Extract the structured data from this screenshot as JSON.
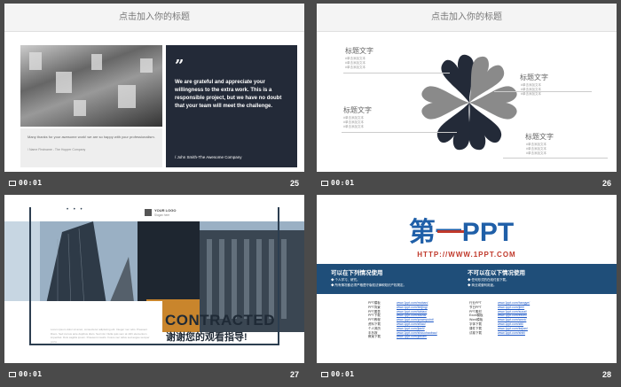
{
  "slides": [
    {
      "header": "点击加入你的标题",
      "quote_mark": "”",
      "quote_text": "We are grateful and appreciate your willingness to the extra work. This is a responsible project, but we have no doubt that your team will meet the challenge.",
      "quote_author": "/ John Smith-The Awesome Company",
      "left_quote": "Many thanks for your awesome work! we are so happy with your professionalism.",
      "left_author": "/ Name Firstname - The Hopper Company",
      "time": "00:01",
      "number": "25"
    },
    {
      "header": "点击加入你的标题",
      "labels": [
        {
          "title": "标题文字",
          "lines": [
            "#单击添加文本",
            "#单击添加文本",
            "#单击添加文本"
          ]
        },
        {
          "title": "标题文字",
          "lines": [
            "#单击添加文本",
            "#单击添加文本",
            "#单击添加文本"
          ]
        },
        {
          "title": "标题文字",
          "lines": [
            "#单击添加文本",
            "#单击添加文本",
            "#单击添加文本"
          ]
        },
        {
          "title": "标题文字",
          "lines": [
            "#单击添加文本",
            "#单击添加文本",
            "#单击添加文本"
          ]
        }
      ],
      "time": "00:01",
      "number": "26"
    },
    {
      "dots": "• • •",
      "logo_title": "YOUR LOGO",
      "logo_sub": "Slogan here",
      "title": "CONTRACTED",
      "subtitle": "谢谢您的观看指导!",
      "paragraph": "Lorem ipsum dolor sit amet, consectetur adipiscing elit. Integer nec odio. Praesent libero. Sed cursus ante dapibus diam. Sed nisi. Nulla quis sem at nibh elementum imperdiet. Duis sagittis ipsum. Praesent mauris. Fusce nec tellus sed augue semper porta.",
      "time": "00:01",
      "number": "27"
    },
    {
      "brand": "第一PPT",
      "url": "HTTP://WWW.1PPT.COM",
      "can_use": {
        "title": "可以在下列情况使用",
        "items": [
          "◆ 个人学习、研究。",
          "◆ 所有情况都必须严格遵守版权法律和知识产权规定。"
        ]
      },
      "cannot_use": {
        "title": "不可以在以下情况使用",
        "items": [
          "◆ 任何形式的在线付费下载。",
          "◆ 商业或营利用途。"
        ]
      },
      "links_left": [
        {
          "k": "PPT模板",
          "v": "www.1ppt.com/moban/"
        },
        {
          "k": "PPT背景",
          "v": "www.1ppt.com/beijing/"
        },
        {
          "k": "PPT图表",
          "v": "www.1ppt.com/tubiao/"
        },
        {
          "k": "PPT下载",
          "v": "www.1ppt.com/xiazai/"
        },
        {
          "k": "PPT教程",
          "v": "www.1ppt.com/powerpoint/"
        },
        {
          "k": "资料下载",
          "v": "www.1ppt.com/ziliao/"
        },
        {
          "k": "个人简历",
          "v": "www.1ppt.com/jianli/"
        },
        {
          "k": "手抄报",
          "v": "www.1ppt.com/shouchaobao/"
        },
        {
          "k": "教案下载",
          "v": "www.1ppt.com/jiaoan/"
        }
      ],
      "links_right": [
        {
          "k": "行业PPT",
          "v": "www.1ppt.com/hangye/"
        },
        {
          "k": "节日PPT",
          "v": "www.1ppt.com/jieri/"
        },
        {
          "k": "PPT素材",
          "v": "www.1ppt.com/sucai/"
        },
        {
          "k": "Excel模板",
          "v": "www.1ppt.com/excel/"
        },
        {
          "k": "Word模板",
          "v": "www.1ppt.com/word/"
        },
        {
          "k": "字体下载",
          "v": "www.1ppt.com/ziti/"
        },
        {
          "k": "课件下载",
          "v": "www.1ppt.com/kejian/"
        },
        {
          "k": "试卷下载",
          "v": "www.1ppt.com/shiti/"
        }
      ],
      "time": "00:01",
      "number": "28"
    }
  ],
  "colors": {
    "dark": "#232a38",
    "grey": "#8a8a8a",
    "blue": "#1f4e79",
    "red": "#c0392b"
  }
}
